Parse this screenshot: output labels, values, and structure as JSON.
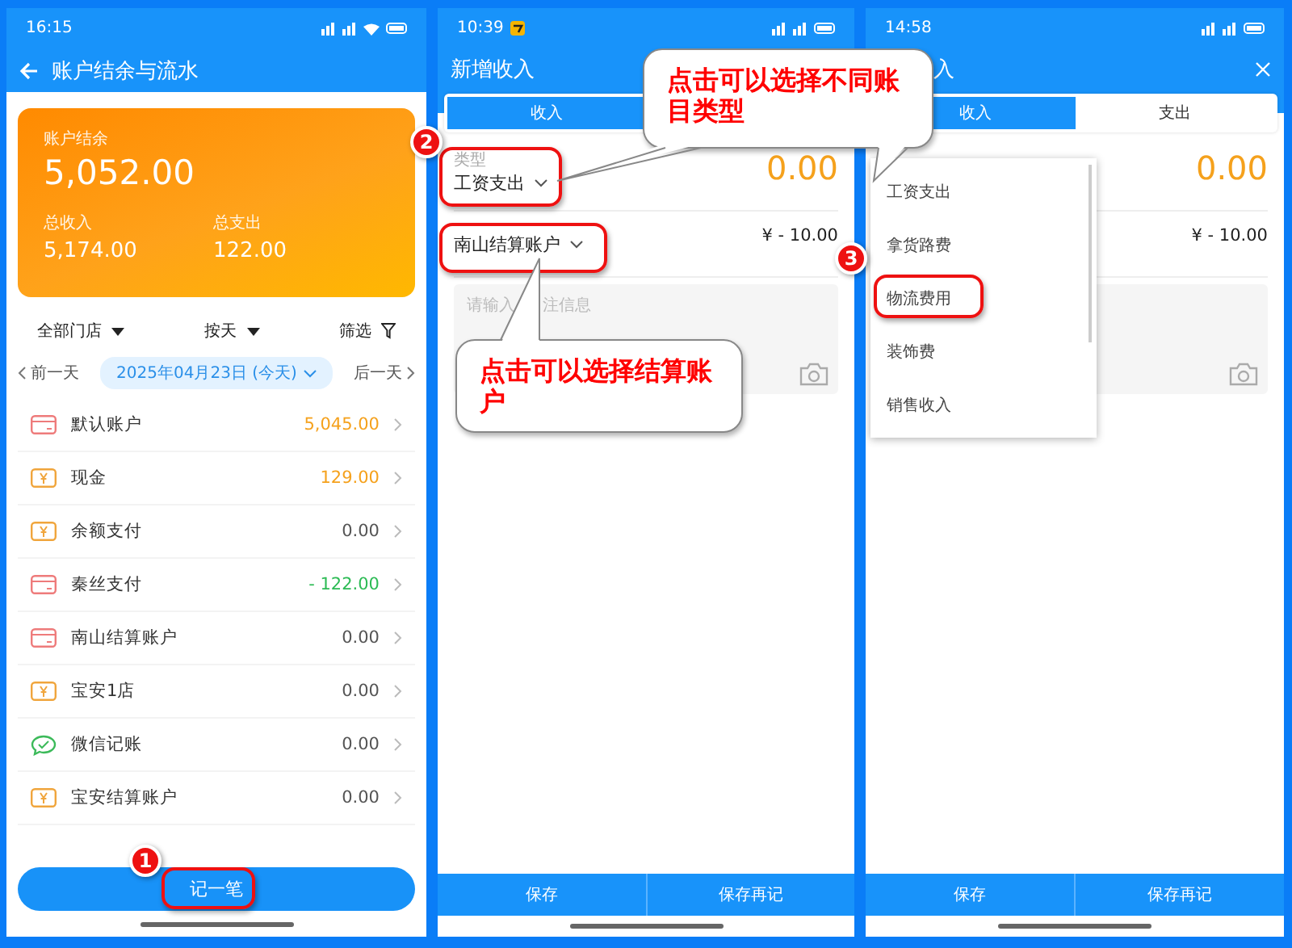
{
  "screens": [
    {
      "kind": "accounts",
      "status_time": "16:15",
      "title": "账户结余与流水",
      "balance_label": "账户结余",
      "balance": "5,052.00",
      "income_label": "总收入",
      "income": "5,174.00",
      "expense_label": "总支出",
      "expense": "122.00",
      "filters": [
        "全部门店",
        "按天",
        "筛选"
      ],
      "prev_day": "前一天",
      "date": "2025年04月23日 (今天)",
      "next_day": "后一天",
      "accounts": [
        {
          "kind": "card",
          "name": "默认账户",
          "amount": "5,045.00",
          "color": "#f5a11c"
        },
        {
          "kind": "cash",
          "name": "现金",
          "amount": "129.00",
          "color": "#f5a11c"
        },
        {
          "kind": "cash",
          "name": "余额支付",
          "amount": "0.00",
          "color": "#555555"
        },
        {
          "kind": "card",
          "name": "秦丝支付",
          "amount": "- 122.00",
          "color": "#2dbb55"
        },
        {
          "kind": "card",
          "name": "南山结算账户",
          "amount": "0.00",
          "color": "#555555"
        },
        {
          "kind": "cash",
          "name": "宝安1店",
          "amount": "0.00",
          "color": "#555555"
        },
        {
          "kind": "chat",
          "name": "微信记账",
          "amount": "0.00",
          "color": "#555555"
        },
        {
          "kind": "cash",
          "name": "宝安结算账户",
          "amount": "0.00",
          "color": "#555555"
        }
      ],
      "action": "记一笔"
    },
    {
      "kind": "entry",
      "status_time": "10:39",
      "app_badge": true,
      "title": "新增收入",
      "title_covered": false,
      "close": false,
      "tabs": [
        {
          "label": "收入",
          "selected": true
        }
      ],
      "type_label": "类型",
      "type_value": "工资支出",
      "amount": "0.00",
      "account_value": "南山结算账户",
      "account_amount": "¥ - 10.00",
      "note_placeholder": [
        "请输入",
        "注信息"
      ],
      "buttons": [
        "保存",
        "保存再记"
      ]
    },
    {
      "kind": "entry",
      "status_time": "14:58",
      "app_badge": false,
      "title": "入",
      "title_covered": true,
      "close": true,
      "tabs": [
        {
          "label": "收入",
          "selected": true
        },
        {
          "label": "支出",
          "selected": false
        }
      ],
      "amount": "0.00",
      "account_amount": "¥ - 10.00",
      "dropdown": [
        "工资支出",
        "拿货路费",
        "物流费用",
        "装饰费",
        "销售收入"
      ],
      "buttons": [
        "保存",
        "保存再记"
      ]
    }
  ],
  "annotations": {
    "steps": [
      "1",
      "2",
      "3"
    ],
    "callouts": [
      "点击可以选择不同账目类型",
      "点击可以选择结算账户"
    ]
  }
}
